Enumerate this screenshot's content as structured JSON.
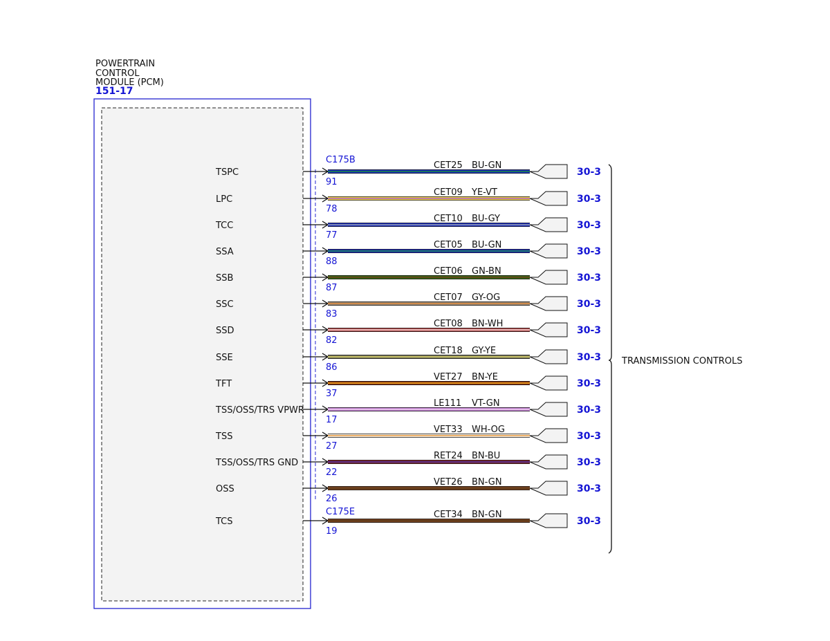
{
  "module": {
    "name_lines": [
      "POWERTRAIN",
      "CONTROL",
      "MODULE (PCM)"
    ],
    "id": "151-17"
  },
  "connectors": [
    {
      "name": "C175B",
      "first_row": 0
    },
    {
      "name": "C175E",
      "first_row": 13
    }
  ],
  "group_label": "TRANSMISSION CONTROLS",
  "circuits": [
    {
      "signal": "TSPC",
      "pin": "91",
      "circuit": "CET25",
      "color_code": "BU-GN",
      "ref": "30-3",
      "wire": [
        "#1c2fc4",
        "#1c8a3a"
      ]
    },
    {
      "signal": "LPC",
      "pin": "78",
      "circuit": "CET09",
      "color_code": "YE-VT",
      "ref": "30-3",
      "wire": [
        "#ecd24a",
        "#b060c0"
      ]
    },
    {
      "signal": "TCC",
      "pin": "77",
      "circuit": "CET10",
      "color_code": "BU-GY",
      "ref": "30-3",
      "wire": [
        "#1c2fc4",
        "#9aa0a8"
      ]
    },
    {
      "signal": "SSA",
      "pin": "88",
      "circuit": "CET05",
      "color_code": "BU-GN",
      "ref": "30-3",
      "wire": [
        "#1c2fc4",
        "#1c8a3a"
      ]
    },
    {
      "signal": "SSB",
      "pin": "87",
      "circuit": "CET06",
      "color_code": "GN-BN",
      "ref": "30-3",
      "wire": [
        "#3a6a18",
        "#6b3d18"
      ]
    },
    {
      "signal": "SSC",
      "pin": "83",
      "circuit": "CET07",
      "color_code": "GY-OG",
      "ref": "30-3",
      "wire": [
        "#9a8a78",
        "#e08a3a"
      ]
    },
    {
      "signal": "SSD",
      "pin": "82",
      "circuit": "CET08",
      "color_code": "BN-WH",
      "ref": "30-3",
      "wire": [
        "#b04848",
        "#f4d8d8"
      ]
    },
    {
      "signal": "SSE",
      "pin": "86",
      "circuit": "CET18",
      "color_code": "GY-YE",
      "ref": "30-3",
      "wire": [
        "#7a7a60",
        "#d8d060"
      ]
    },
    {
      "signal": "TFT",
      "pin": "37",
      "circuit": "VET27",
      "color_code": "BN-YE",
      "ref": "30-3",
      "wire": [
        "#8a3010",
        "#f0b020"
      ]
    },
    {
      "signal": "TSS/OSS/TRS VPWR",
      "pin": "17",
      "circuit": "LE111",
      "color_code": "VT-GN",
      "ref": "30-3",
      "wire": [
        "#c080d0",
        "#f0d0f0"
      ]
    },
    {
      "signal": "TSS",
      "pin": "27",
      "circuit": "VET33",
      "color_code": "WH-OG",
      "ref": "30-3",
      "wire": [
        "#f6f0e6",
        "#e89a40"
      ]
    },
    {
      "signal": "TSS/OSS/TRS GND",
      "pin": "22",
      "circuit": "RET24",
      "color_code": "BN-BU",
      "ref": "30-3",
      "wire": [
        "#8a2a30",
        "#3a2a9a"
      ]
    },
    {
      "signal": "OSS",
      "pin": "26",
      "circuit": "VET26",
      "color_code": "BN-GN",
      "ref": "30-3",
      "wire": [
        "#7a4422",
        "#5a3a18"
      ]
    },
    {
      "signal": "TCS",
      "pin": "19",
      "circuit": "CET34",
      "color_code": "BN-GN",
      "ref": "30-3",
      "wire": [
        "#7a4422",
        "#5a3a18"
      ]
    }
  ]
}
